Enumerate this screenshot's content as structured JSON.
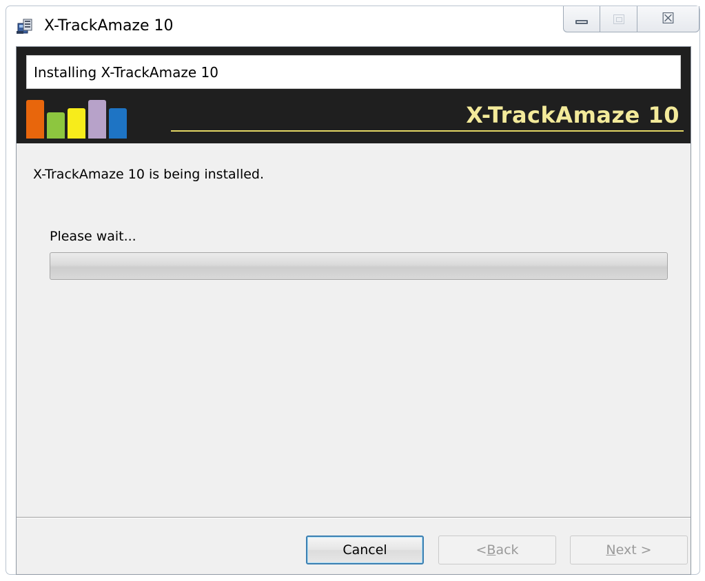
{
  "window": {
    "title": "X-TrackAmaze 10",
    "icon": "installer-package-icon",
    "controls": {
      "minimize_icon": "minimize-icon",
      "maximize_icon": "maximize-icon",
      "close_label": "☒",
      "close_icon": "close-icon"
    }
  },
  "banner": {
    "heading": "Installing X-TrackAmaze 10",
    "brand": "X-TrackAmaze 10",
    "logo_colors": [
      "#e8660c",
      "#8dc63f",
      "#f7ec1b",
      "#b7a2c9",
      "#1e74c4"
    ],
    "accent": "#e4d764"
  },
  "body": {
    "status": "X-TrackAmaze 10 is being installed.",
    "wait_label": "Please wait...",
    "progress": 0
  },
  "buttons": {
    "cancel": "Cancel",
    "back": "< Back",
    "next": "Next >"
  }
}
